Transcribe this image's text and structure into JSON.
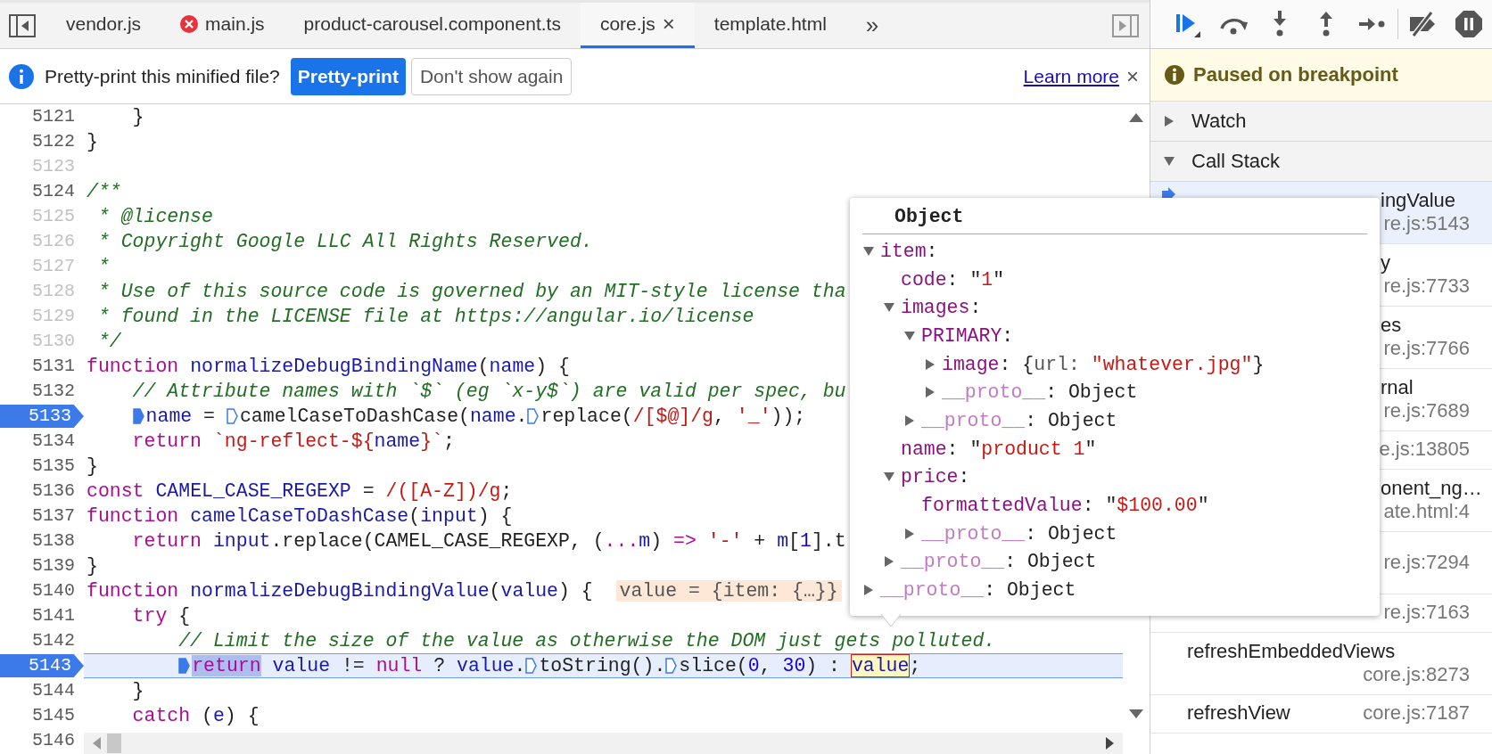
{
  "source_tabs": {
    "tabs": [
      {
        "label": "vendor.js",
        "selected": false,
        "error": false
      },
      {
        "label": "main.js",
        "selected": false,
        "error": true
      },
      {
        "label": "product-carousel.component.ts",
        "selected": false,
        "error": false
      },
      {
        "label": "core.js",
        "selected": true,
        "error": false,
        "close": "×"
      },
      {
        "label": "template.html",
        "selected": false,
        "error": false
      }
    ],
    "overflow": "»"
  },
  "infobar": {
    "message": "Pretty-print this minified file?",
    "primary_button": "Pretty-print",
    "secondary_button": "Don't show again",
    "link": "Learn more",
    "close": "×"
  },
  "editor": {
    "lines": [
      {
        "number": "5121",
        "breakable": true,
        "breakpoint": false,
        "current": false,
        "kind": "block",
        "tokens": [
          {
            "kind": "plain",
            "text": "}"
          }
        ]
      },
      {
        "number": "5122",
        "breakable": true,
        "breakpoint": false,
        "current": false,
        "tokens": [
          {
            "kind": "plain",
            "text": "}"
          }
        ]
      },
      {
        "number": "5123",
        "breakable": false,
        "breakpoint": false,
        "current": false
      },
      {
        "number": "5124",
        "breakable": true,
        "breakpoint": false,
        "current": false,
        "tokens": [
          {
            "kind": "comment",
            "text": "/**"
          }
        ]
      },
      {
        "number": "5125",
        "breakable": false,
        "breakpoint": false,
        "current": false,
        "tokens": [
          {
            "kind": "comment",
            "text": " * @license"
          }
        ]
      },
      {
        "number": "5126",
        "breakable": false,
        "breakpoint": false,
        "current": false,
        "tokens": [
          {
            "kind": "comment",
            "text": " * Copyright Google LLC All Rights Reserved."
          }
        ]
      },
      {
        "number": "5127",
        "breakable": false,
        "breakpoint": false,
        "current": false,
        "tokens": [
          {
            "kind": "comment",
            "text": " *"
          }
        ]
      },
      {
        "number": "5128",
        "breakable": false,
        "breakpoint": false,
        "current": false,
        "tokens": [
          {
            "kind": "comment",
            "text": " * Use of this source code is governed by an MIT-style license tha"
          }
        ]
      },
      {
        "number": "5129",
        "breakable": false,
        "breakpoint": false,
        "current": false,
        "tokens": [
          {
            "kind": "comment",
            "text": " * found in the LICENSE file at https://angular.io/license"
          }
        ]
      },
      {
        "number": "5130",
        "breakable": false,
        "breakpoint": false,
        "current": false,
        "tokens": [
          {
            "kind": "comment",
            "text": " */"
          }
        ]
      },
      {
        "number": "5131",
        "breakable": true,
        "breakpoint": false,
        "current": false,
        "tokens": [
          {
            "kind": "keyword",
            "text": "function "
          },
          {
            "kind": "def",
            "text": "normalizeDebugBindingName"
          },
          {
            "kind": "plain",
            "text": "("
          },
          {
            "kind": "def",
            "text": "name"
          },
          {
            "kind": "plain",
            "text": ") {"
          }
        ]
      },
      {
        "number": "5132",
        "breakable": true,
        "breakpoint": false,
        "current": false,
        "kind": "block",
        "tokens": [
          {
            "kind": "comment",
            "text": "// Attribute names with `$` (eg `x-y$`) are valid per spec, bu"
          }
        ]
      },
      {
        "number": "5133",
        "breakable": true,
        "breakpoint": true,
        "current": false,
        "kind": "block",
        "tokens": [
          {
            "kind": "marker-on"
          },
          {
            "kind": "def",
            "text": "name"
          },
          {
            "kind": "plain",
            "text": " = "
          },
          {
            "kind": "marker-off"
          },
          {
            "kind": "plain",
            "text": "camelCaseToDashCase("
          },
          {
            "kind": "def",
            "text": "name"
          },
          {
            "kind": "plain",
            "text": "."
          },
          {
            "kind": "marker-off"
          },
          {
            "kind": "plain",
            "text": "replace("
          },
          {
            "kind": "regex",
            "text": "/[$@]/g"
          },
          {
            "kind": "plain",
            "text": ", "
          },
          {
            "kind": "string",
            "text": "'_'"
          },
          {
            "kind": "plain",
            "text": "));"
          }
        ]
      },
      {
        "number": "5134",
        "breakable": true,
        "breakpoint": false,
        "current": false,
        "kind": "block",
        "tokens": [
          {
            "kind": "keyword",
            "text": "return "
          },
          {
            "kind": "string",
            "text": "`ng-reflect-${"
          },
          {
            "kind": "def",
            "text": "name"
          },
          {
            "kind": "string",
            "text": "}`"
          },
          {
            "kind": "plain",
            "text": ";"
          }
        ]
      },
      {
        "number": "5135",
        "breakable": true,
        "breakpoint": false,
        "current": false,
        "tokens": [
          {
            "kind": "plain",
            "text": "}"
          }
        ]
      },
      {
        "number": "5136",
        "breakable": true,
        "breakpoint": false,
        "current": false,
        "tokens": [
          {
            "kind": "keyword",
            "text": "const "
          },
          {
            "kind": "def",
            "text": "CAMEL_CASE_REGEXP"
          },
          {
            "kind": "plain",
            "text": " = "
          },
          {
            "kind": "regex",
            "text": "/([A-Z])/g"
          },
          {
            "kind": "plain",
            "text": ";"
          }
        ]
      },
      {
        "number": "5137",
        "breakable": true,
        "breakpoint": false,
        "current": false,
        "tokens": [
          {
            "kind": "keyword",
            "text": "function "
          },
          {
            "kind": "def",
            "text": "camelCaseToDashCase"
          },
          {
            "kind": "plain",
            "text": "("
          },
          {
            "kind": "def",
            "text": "input"
          },
          {
            "kind": "plain",
            "text": ") {"
          }
        ]
      },
      {
        "number": "5138",
        "breakable": true,
        "breakpoint": false,
        "current": false,
        "kind": "block",
        "tokens": [
          {
            "kind": "keyword",
            "text": "return "
          },
          {
            "kind": "def",
            "text": "input"
          },
          {
            "kind": "plain",
            "text": ".replace(CAMEL_CASE_REGEXP, ("
          },
          {
            "kind": "keyword",
            "text": "..."
          },
          {
            "kind": "def",
            "text": "m"
          },
          {
            "kind": "plain",
            "text": ") "
          },
          {
            "kind": "keyword",
            "text": "=>"
          },
          {
            "kind": "string",
            "text": " '-'"
          },
          {
            "kind": "plain",
            "text": " + "
          },
          {
            "kind": "def",
            "text": "m"
          },
          {
            "kind": "plain",
            "text": "["
          },
          {
            "kind": "number",
            "text": "1"
          },
          {
            "kind": "plain",
            "text": "].t"
          }
        ]
      },
      {
        "number": "5139",
        "breakable": true,
        "breakpoint": false,
        "current": false,
        "tokens": [
          {
            "kind": "plain",
            "text": "}"
          }
        ]
      },
      {
        "number": "5140",
        "breakable": true,
        "breakpoint": false,
        "current": false,
        "tokens": [
          {
            "kind": "keyword",
            "text": "function "
          },
          {
            "kind": "def",
            "text": "normalizeDebugBindingValue"
          },
          {
            "kind": "plain",
            "text": "("
          },
          {
            "kind": "def",
            "text": "value"
          },
          {
            "kind": "plain",
            "text": ") {"
          },
          {
            "kind": "inline-value",
            "text": "value = {item: {…}}"
          }
        ]
      },
      {
        "number": "5141",
        "breakable": true,
        "breakpoint": false,
        "current": false,
        "kind": "block",
        "tokens": [
          {
            "kind": "keyword",
            "text": "try"
          },
          {
            "kind": "plain",
            "text": " {"
          }
        ]
      },
      {
        "number": "5142",
        "breakable": true,
        "breakpoint": false,
        "current": false,
        "kind": "nested",
        "tokens": [
          {
            "kind": "comment",
            "text": "// Limit the size of the value as otherwise the DOM just gets polluted."
          }
        ]
      },
      {
        "number": "5143",
        "breakable": true,
        "breakpoint": true,
        "current": true,
        "kind": "nested",
        "tokens": [
          {
            "kind": "marker-on"
          },
          {
            "kind": "keyword-selected",
            "text": "return"
          },
          {
            "kind": "def",
            "text": " value"
          },
          {
            "kind": "plain",
            "text": " != "
          },
          {
            "kind": "keyword",
            "text": "null"
          },
          {
            "kind": "plain",
            "text": " ? "
          },
          {
            "kind": "def",
            "text": "value"
          },
          {
            "kind": "plain",
            "text": "."
          },
          {
            "kind": "marker-off"
          },
          {
            "kind": "plain",
            "text": "toString()."
          },
          {
            "kind": "marker-off"
          },
          {
            "kind": "plain",
            "text": "slice("
          },
          {
            "kind": "number",
            "text": "0"
          },
          {
            "kind": "plain",
            "text": ", "
          },
          {
            "kind": "number",
            "text": "30"
          },
          {
            "kind": "plain",
            "text": ") : "
          },
          {
            "kind": "hovered",
            "text": "value"
          },
          {
            "kind": "plain",
            "text": ";"
          }
        ]
      },
      {
        "number": "5144",
        "breakable": true,
        "breakpoint": false,
        "current": false,
        "kind": "block",
        "tokens": [
          {
            "kind": "plain",
            "text": "}"
          }
        ]
      },
      {
        "number": "5145",
        "breakable": true,
        "breakpoint": false,
        "current": false,
        "kind": "block",
        "tokens": [
          {
            "kind": "keyword",
            "text": "catch"
          },
          {
            "kind": "plain",
            "text": " ("
          },
          {
            "kind": "def",
            "text": "e"
          },
          {
            "kind": "plain",
            "text": ") {"
          }
        ]
      },
      {
        "number": "5146",
        "breakable": true,
        "breakpoint": false,
        "current": false
      }
    ]
  },
  "popover": {
    "title": "Object",
    "tree": [
      {
        "key": "item",
        "kind": "property",
        "expanded": true,
        "value": [
          {
            "kind": "plain",
            "text": ":"
          }
        ],
        "children": [
          {
            "key": "code",
            "kind": "property",
            "value": [
              {
                "kind": "plain",
                "text": ": \""
              },
              {
                "kind": "string",
                "text": "1"
              },
              {
                "kind": "plain",
                "text": "\""
              }
            ]
          },
          {
            "key": "images",
            "kind": "property",
            "expanded": true,
            "value": [
              {
                "kind": "plain",
                "text": ":"
              }
            ],
            "children": [
              {
                "key": "PRIMARY",
                "kind": "property",
                "expanded": true,
                "value": [
                  {
                    "kind": "plain",
                    "text": ":"
                  }
                ],
                "children": [
                  {
                    "key": "image",
                    "kind": "property",
                    "expanded": false,
                    "value": [
                      {
                        "kind": "plain",
                        "text": ": {"
                      },
                      {
                        "kind": "muted",
                        "text": "url: "
                      },
                      {
                        "kind": "string",
                        "text": "\"whatever.jpg\""
                      },
                      {
                        "kind": "plain",
                        "text": "}"
                      }
                    ]
                  },
                  {
                    "key": "__proto__",
                    "kind": "internal",
                    "expanded": false,
                    "value": [
                      {
                        "kind": "plain",
                        "text": ": Object"
                      }
                    ]
                  }
                ]
              },
              {
                "key": "__proto__",
                "kind": "internal",
                "expanded": false,
                "value": [
                  {
                    "kind": "plain",
                    "text": ": Object"
                  }
                ]
              }
            ]
          },
          {
            "key": "name",
            "kind": "property",
            "value": [
              {
                "kind": "plain",
                "text": ": \""
              },
              {
                "kind": "string",
                "text": "product 1"
              },
              {
                "kind": "plain",
                "text": "\""
              }
            ]
          },
          {
            "key": "price",
            "kind": "property",
            "expanded": true,
            "value": [
              {
                "kind": "plain",
                "text": ":"
              }
            ],
            "children": [
              {
                "key": "formattedValue",
                "kind": "property",
                "value": [
                  {
                    "kind": "plain",
                    "text": ": \""
                  },
                  {
                    "kind": "string",
                    "text": "$100.00"
                  },
                  {
                    "kind": "plain",
                    "text": "\""
                  }
                ]
              },
              {
                "key": "__proto__",
                "kind": "internal",
                "expanded": false,
                "value": [
                  {
                    "kind": "plain",
                    "text": ": Object"
                  }
                ]
              }
            ]
          },
          {
            "key": "__proto__",
            "kind": "internal",
            "expanded": false,
            "value": [
              {
                "kind": "plain",
                "text": ": Object"
              }
            ]
          }
        ]
      },
      {
        "key": "__proto__",
        "kind": "internal",
        "expanded": false,
        "value": [
          {
            "kind": "plain",
            "text": ": Object"
          }
        ]
      }
    ]
  },
  "debugger": {
    "banner": "Paused on breakpoint",
    "sections": [
      {
        "label": "Watch",
        "expanded": false
      },
      {
        "label": "Call Stack",
        "expanded": true
      }
    ],
    "frames": [
      {
        "name": "ingValue",
        "location": "re.js:5143",
        "kind": "stacked",
        "clipped": true,
        "current": true
      },
      {
        "name": "y",
        "location": "re.js:7733",
        "kind": "stacked",
        "clipped": true,
        "current": false
      },
      {
        "name": "es",
        "location": "re.js:7766",
        "kind": "stacked",
        "clipped": true,
        "current": false
      },
      {
        "name": "rnal",
        "location": "re.js:7689",
        "kind": "stacked",
        "clipped": true,
        "current": false
      },
      {
        "location": "e.js:13805",
        "kind": "inline",
        "current": false
      },
      {
        "name": "onent_ng…",
        "location": "ate.html:4",
        "kind": "stacked",
        "clipped": true,
        "current": false
      },
      {
        "location": "re.js:7294",
        "kind": "stacked",
        "current": false
      },
      {
        "location": "re.js:7163",
        "kind": "inline",
        "current": false
      },
      {
        "name": "refreshEmbeddedViews",
        "location": "core.js:8273",
        "kind": "stacked",
        "clipped": false,
        "current": false
      },
      {
        "name": "refreshView",
        "location": "core.js:7187",
        "kind": "inline",
        "clipped": false,
        "current": false
      }
    ]
  }
}
